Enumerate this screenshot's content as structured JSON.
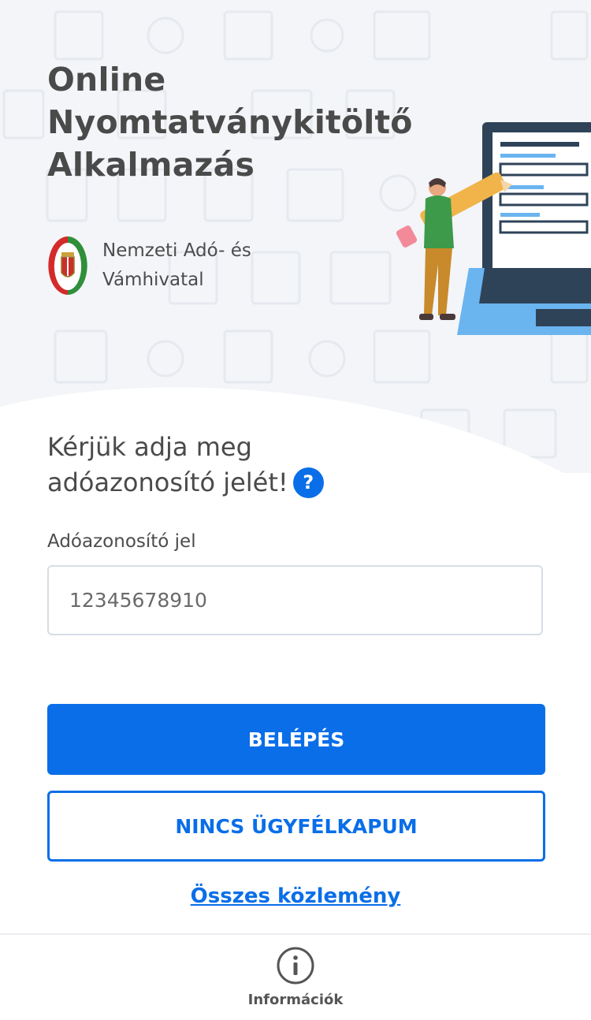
{
  "header": {
    "title": "Online Nyomtatványkitöltő Alkalmazás",
    "agency_name": "Nemzeti Adó- és Vámhivatal"
  },
  "login": {
    "prompt": "Kérjük adja meg adóazonosító jelét!",
    "help_icon": "?",
    "field_label": "Adóazonosító jel",
    "field_placeholder": "12345678910",
    "field_value": ""
  },
  "actions": {
    "primary_label": "BELÉPÉS",
    "secondary_label": "NINCS ÜGYFÉLKAPUM",
    "link_label": "Összes közlemény"
  },
  "bottom_nav": {
    "items": [
      {
        "label": "Információk",
        "icon": "info-icon"
      }
    ]
  },
  "colors": {
    "accent": "#0a6ee8",
    "hero_background": "#f3f5f8",
    "text": "#4a4a4a"
  }
}
